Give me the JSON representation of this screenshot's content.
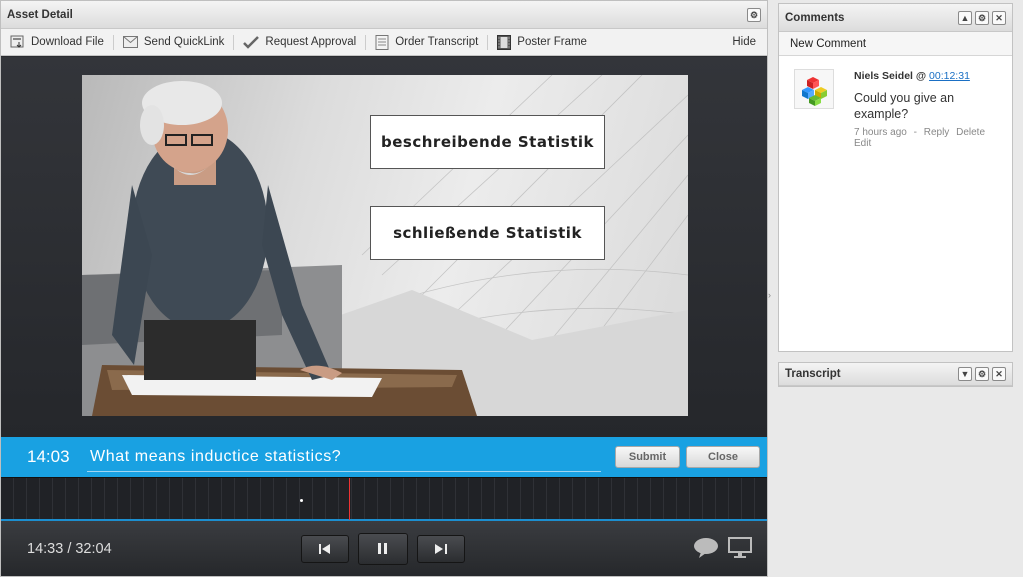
{
  "asset": {
    "title": "Asset Detail",
    "toolbar": {
      "download": "Download File",
      "quicklink": "Send QuickLink",
      "approval": "Request Approval",
      "transcript": "Order Transcript",
      "poster": "Poster Frame",
      "hide": "Hide"
    },
    "video": {
      "slide_label_1": "beschreibende Statistik",
      "slide_label_2": "schließende Statistik"
    },
    "question": {
      "time": "14:03",
      "value": "What means inductice statistics?",
      "submit": "Submit",
      "close": "Close"
    },
    "player": {
      "time": "14:33 / 32:04"
    }
  },
  "comments": {
    "title": "Comments",
    "new_comment": "New Comment",
    "items": [
      {
        "author": "Niels Seidel @",
        "timestamp": "00:12:31",
        "text": "Could you give an example?",
        "age": "7 hours ago",
        "sep": "-",
        "reply": "Reply",
        "delete": "Delete",
        "edit": "Edit"
      }
    ]
  },
  "transcript": {
    "title": "Transcript"
  },
  "colors": {
    "accent": "#19a1e2",
    "playhead": "#ee3333",
    "link": "#1a6fc4"
  },
  "icons": [
    "gear-icon",
    "close-icon",
    "collapse-up-icon",
    "collapse-down-icon",
    "download-icon",
    "mail-icon",
    "check-icon",
    "document-icon",
    "film-icon",
    "prev-icon",
    "pause-icon",
    "next-icon",
    "comment-bubble-icon",
    "screen-icon"
  ]
}
